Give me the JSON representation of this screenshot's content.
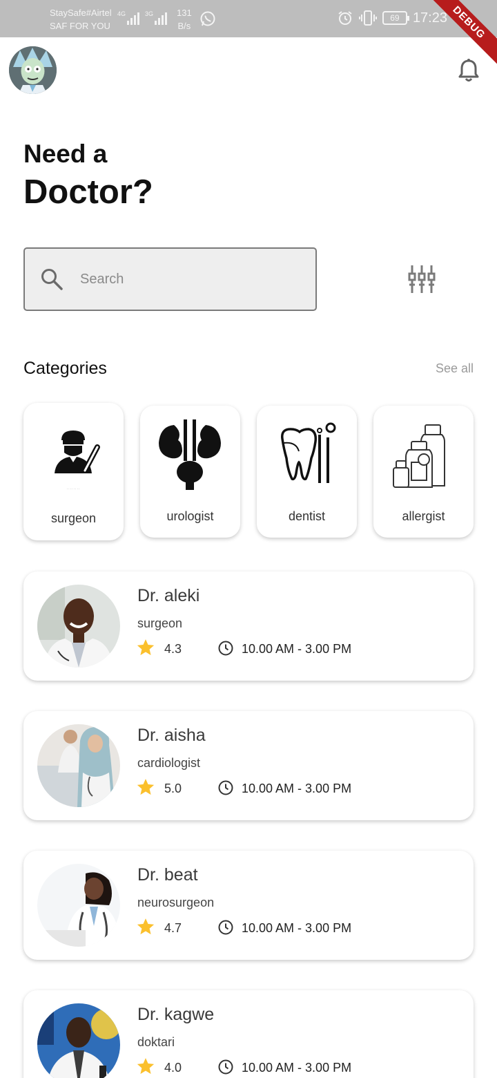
{
  "status_bar": {
    "carrier_line1": "StaySafe#Airtel",
    "carrier_line2": "SAF FOR YOU",
    "network_speed_value": "131",
    "network_speed_unit": "B/s",
    "battery": "69",
    "time": "17:23",
    "debug_banner": "DEBUG"
  },
  "header": {
    "avatar_icon": "user-avatar",
    "notification_icon": "bell-icon"
  },
  "hero": {
    "line1": "Need a",
    "line2": "Doctor?"
  },
  "search": {
    "placeholder": "Search",
    "value": "",
    "filter_icon": "filter-sliders-icon"
  },
  "categories": {
    "heading": "Categories",
    "see_all": "See all",
    "items": [
      {
        "label": "surgeon",
        "icon": "surgeon-icon"
      },
      {
        "label": "urologist",
        "icon": "kidney-icon"
      },
      {
        "label": "dentist",
        "icon": "tooth-icon"
      },
      {
        "label": "allergist",
        "icon": "medicine-bottles-icon"
      }
    ]
  },
  "doctors": [
    {
      "name": "Dr. aleki",
      "specialty": "surgeon",
      "rating": "4.3",
      "hours": "10.00 AM - 3.00 PM"
    },
    {
      "name": "Dr. aisha",
      "specialty": "cardiologist",
      "rating": "5.0",
      "hours": "10.00 AM - 3.00 PM"
    },
    {
      "name": "Dr. beat",
      "specialty": "neurosurgeon",
      "rating": "4.7",
      "hours": "10.00 AM - 3.00 PM"
    },
    {
      "name": "Dr. kagwe",
      "specialty": "doktari",
      "rating": "4.0",
      "hours": "10.00 AM - 3.00 PM"
    }
  ],
  "colors": {
    "star": "#fbc02d",
    "status_bar": "#bdbdbd",
    "debug": "#b71c1c"
  }
}
